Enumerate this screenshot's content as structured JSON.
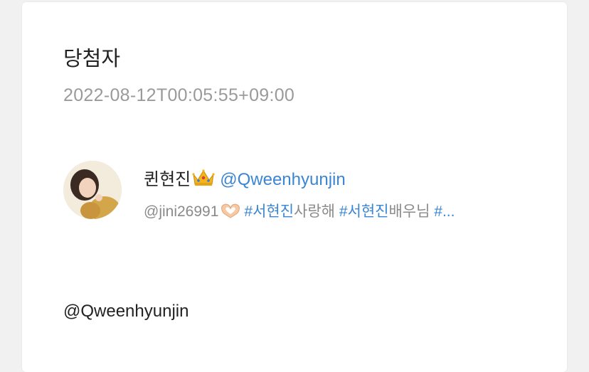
{
  "card": {
    "title": "당첨자",
    "timestamp": "2022-08-12T00:05:55+09:00",
    "profile": {
      "display_name": "퀸현진",
      "name_emoji": "crown-icon",
      "handle": "@Qweenhyunjin",
      "bio": {
        "mention": "@jini26991",
        "emoji": "heart-hands-icon",
        "tag1": "#서현진",
        "text1": "사랑해 ",
        "tag2": "#서현진",
        "text2": "배우님 ",
        "tag3": "#..."
      }
    },
    "mention_text": "@Qweenhyunjin"
  },
  "colors": {
    "background": "#f1f1f1",
    "card": "#ffffff",
    "link": "#3a86d4",
    "muted": "#9a9a9a"
  }
}
